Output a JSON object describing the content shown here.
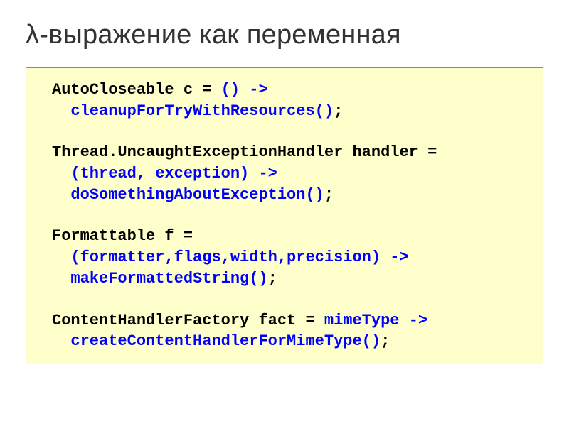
{
  "title": "λ-выражение как переменная",
  "code": {
    "l1a": "AutoCloseable c = ",
    "l1b": "() ->",
    "l2a": "cleanupForTryWithResources()",
    "l2b": ";",
    "l3": "Thread.UncaughtExceptionHandler handler =",
    "l4": "(thread, exception) ->",
    "l5a": "doSomethingAboutException()",
    "l5b": ";",
    "l6": "Formattable f =",
    "l7": "(formatter,flags,width,precision) ->",
    "l8a": "makeFormattedString()",
    "l8b": ";",
    "l9a": "ContentHandlerFactory fact = ",
    "l9b": "mimeType ->",
    "l10a": "createContentHandlerForMimeType()",
    "l10b": ";"
  }
}
